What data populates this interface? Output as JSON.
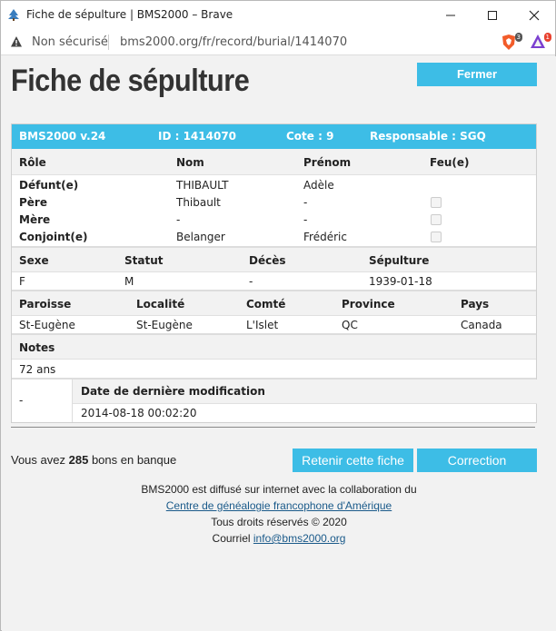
{
  "window": {
    "title": "Fiche de sépulture | BMS2000 – Brave",
    "insecure_label": "Non sécurisé",
    "url": "bms2000.org/fr/record/burial/1414070",
    "brave_badge": "3",
    "rewards_badge": "1"
  },
  "page": {
    "title": "Fiche de sépulture",
    "close_label": "Fermer"
  },
  "record": {
    "header": {
      "version": "BMS2000 v.24",
      "id": "ID : 1414070",
      "cote": "Cote : 9",
      "responsable": "Responsable : SGQ"
    },
    "persons_head": {
      "role": "Rôle",
      "nom": "Nom",
      "prenom": "Prénom",
      "feu": "Feu(e)"
    },
    "persons": [
      {
        "role": "Défunt(e)",
        "nom": "THIBAULT",
        "prenom": "Adèle"
      },
      {
        "role": "Père",
        "nom": "Thibault",
        "prenom": "-"
      },
      {
        "role": "Mère",
        "nom": "-",
        "prenom": "-"
      },
      {
        "role": "Conjoint(e)",
        "nom": "Belanger",
        "prenom": "Frédéric"
      }
    ],
    "info_head": {
      "sexe": "Sexe",
      "statut": "Statut",
      "deces": "Décès",
      "sepulture": "Sépulture"
    },
    "info": {
      "sexe": "F",
      "statut": "M",
      "deces": "-",
      "sepulture": "1939-01-18"
    },
    "place_head": {
      "paroisse": "Paroisse",
      "localite": "Localité",
      "comte": "Comté",
      "province": "Province",
      "pays": "Pays"
    },
    "place": {
      "paroisse": "St-Eugène",
      "localite": "St-Eugène",
      "comte": "L'Islet",
      "province": "QC",
      "pays": "Canada"
    },
    "notes_head": "Notes",
    "notes": "72 ans",
    "mod_left": "-",
    "mod_head": "Date de dernière modification",
    "mod_date": "2014-08-18 00:02:20"
  },
  "footer": {
    "bons_prefix": "Vous avez",
    "bons_count": "285",
    "bons_suffix": "bons en banque",
    "retain_label": "Retenir cette fiche",
    "correction_label": "Correction",
    "credit_line": "BMS2000 est diffusé sur internet avec la collaboration du",
    "credit_link": "Centre de généalogie francophone d'Amérique",
    "rights": "Tous droits réservés © 2020",
    "email_prefix": "Courriel",
    "email": "info@bms2000.org"
  },
  "colors": {
    "accent": "#3dbde6",
    "link": "#1a5a8a",
    "warning": "#444444"
  }
}
